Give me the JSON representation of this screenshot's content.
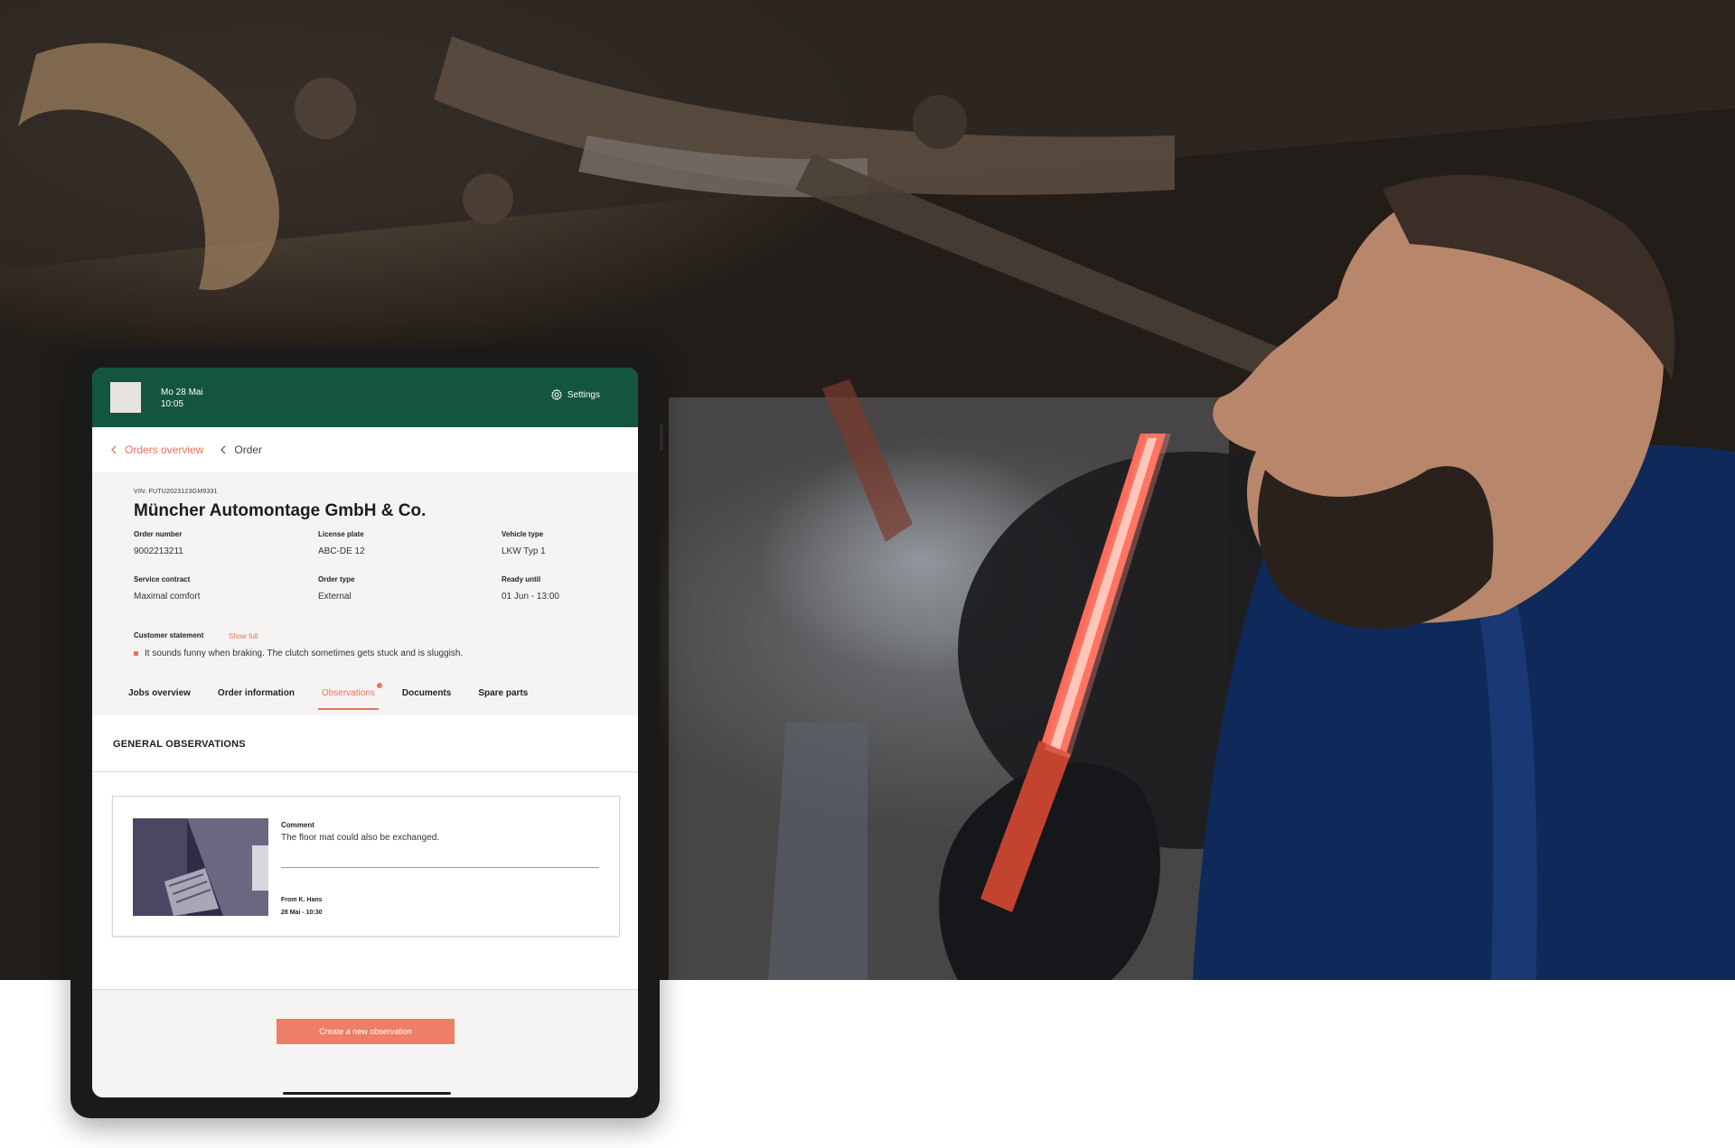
{
  "header": {
    "date": "Mo 28 Mai",
    "time": "10:05",
    "settings_label": "Settings"
  },
  "breadcrumb": {
    "parent": "Orders overview",
    "current": "Order"
  },
  "order": {
    "vin": "VIN: FUTU2023123GM9331",
    "company": "Müncher Automontage GmbH & Co.",
    "fields": [
      {
        "label": "Order number",
        "value": "9002213211"
      },
      {
        "label": "License plate",
        "value": "ABC-DE 12"
      },
      {
        "label": "Vehicle type",
        "value": "LKW Typ 1"
      },
      {
        "label": "Service contract",
        "value": "Maximal comfort"
      },
      {
        "label": "Order type",
        "value": "External"
      },
      {
        "label": "Ready until",
        "value": "01 Jun - 13:00"
      }
    ],
    "customer_statement_label": "Customer statement",
    "show_full_label": "Show full",
    "customer_statement": "It sounds funny when braking. The clutch sometimes gets stuck and is sluggish."
  },
  "tabs": [
    {
      "label": "Jobs overview",
      "active": false
    },
    {
      "label": "Order information",
      "active": false
    },
    {
      "label": "Observations",
      "active": true
    },
    {
      "label": "Documents",
      "active": false
    },
    {
      "label": "Spare parts",
      "active": false
    }
  ],
  "observations": {
    "section_title": "GENERAL OBSERVATIONS",
    "items": [
      {
        "comment_label": "Comment",
        "comment": "The floor mat could also be exchanged.",
        "from": "From K. Hans",
        "timestamp": "28 Mai - 10:30"
      }
    ]
  },
  "actions": {
    "create_label": "Create a new observation"
  },
  "colors": {
    "brand_green": "#13553f",
    "accent": "#e8735b"
  }
}
